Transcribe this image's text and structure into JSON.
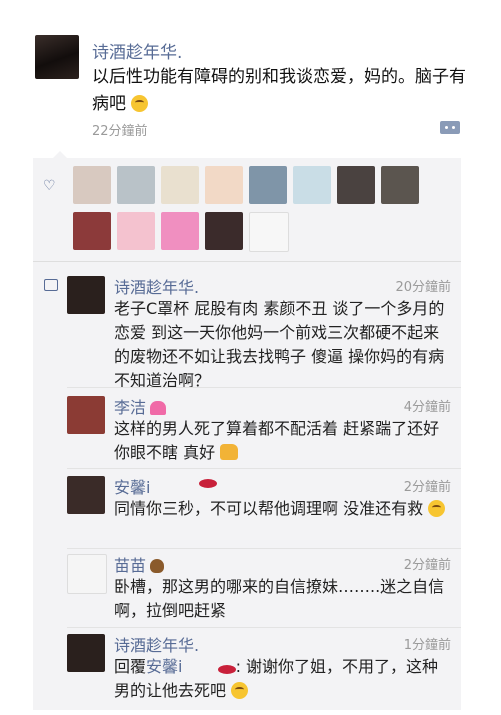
{
  "post": {
    "author": "诗酒趁年华.",
    "text": "以后性功能有障碍的别和我谈恋爱，妈的。脑子有病吧",
    "time": "22分鐘前",
    "more_icon": "more-dots-icon"
  },
  "likes": {
    "icon": "heart-outline-icon",
    "avatars": [
      {
        "color": "#d8c9c0"
      },
      {
        "color": "#b9c2c8"
      },
      {
        "color": "#e9e0cf"
      },
      {
        "color": "#f2d9c6"
      },
      {
        "color": "#7f95a8"
      },
      {
        "color": "#c9dde6"
      },
      {
        "color": "#4a4240"
      },
      {
        "color": "#5b554f"
      },
      {
        "color": "#8c3a3a"
      },
      {
        "color": "#f4c2cf"
      },
      {
        "color": "#f08fc0"
      },
      {
        "color": "#3b2b2b"
      },
      {
        "color": "#f7f7f7"
      }
    ]
  },
  "comments": [
    {
      "name": "诗酒趁年华.",
      "name_emoji": "",
      "time": "20分鐘前",
      "text": "老子C罩杯 屁股有肉 素颜不丑 谈了一个多月的恋爱 到这一天你他妈一个前戏三次都硬不起来的废物还不如让我去找鸭子 傻逼 操你妈的有病不知道治啊？",
      "avatar_color": "#2a201d"
    },
    {
      "name": "李洁",
      "name_emoji": "heart-icon",
      "time": "4分鐘前",
      "text": "这样的男人死了算着都不配活着 赶紧踹了还好你眼不瞎 真好",
      "avatar_color": "#8b3b34"
    },
    {
      "name": "安馨i",
      "name_emoji": "lips-icon",
      "time": "2分鐘前",
      "text": "同情你三秒，不可以帮他调理啊 没准还有救",
      "avatar_color": "#3a2b28"
    },
    {
      "name": "苗苗",
      "name_emoji": "poo-icon",
      "time": "2分鐘前",
      "text": "卧槽，那这男的哪来的自信撩妹……..迷之自信啊，拉倒吧赶紧",
      "avatar_color": "#f5f5f5"
    },
    {
      "name": "诗酒趁年华.",
      "name_emoji": "",
      "time": "1分鐘前",
      "reply_prefix": "回覆",
      "reply_to": "安馨i",
      "text": ": 谢谢你了姐，不用了，这种男的让他去死吧",
      "avatar_color": "#2a201d"
    }
  ]
}
